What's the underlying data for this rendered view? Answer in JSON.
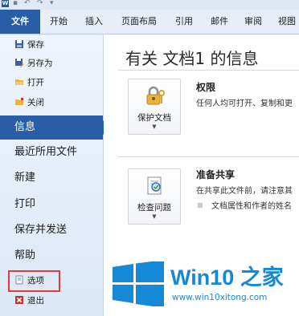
{
  "qat": {
    "app_icon": "W"
  },
  "ribbon": {
    "tabs": [
      {
        "label": "文件"
      },
      {
        "label": "开始"
      },
      {
        "label": "插入"
      },
      {
        "label": "页面布局"
      },
      {
        "label": "引用"
      },
      {
        "label": "邮件"
      },
      {
        "label": "审阅"
      },
      {
        "label": "视图"
      }
    ],
    "active_color": "#2a5da8"
  },
  "backstage": {
    "small_commands": [
      {
        "label": "保存",
        "icon": "save-icon"
      },
      {
        "label": "另存为",
        "icon": "save-as-icon"
      },
      {
        "label": "打开",
        "icon": "open-folder-icon"
      },
      {
        "label": "关闭",
        "icon": "close-folder-icon"
      }
    ],
    "big_commands": [
      {
        "label": "信息",
        "selected": true
      },
      {
        "label": "最近所用文件"
      },
      {
        "label": "新建"
      },
      {
        "label": "打印"
      },
      {
        "label": "保存并发送"
      },
      {
        "label": "帮助"
      }
    ],
    "bottom_commands": [
      {
        "label": "选项",
        "icon": "options-icon"
      },
      {
        "label": "退出",
        "icon": "exit-icon"
      }
    ]
  },
  "info": {
    "title": "有关 文档1 的信息",
    "permissions": {
      "button_label": "保护文档",
      "title": "权限",
      "description": "任何人均可打开、复制和更"
    },
    "prepare": {
      "button_label": "检查问题",
      "title": "准备共享",
      "description": "在共享此文件前，请注意其",
      "bullet": "文档属性和作者的姓名"
    }
  },
  "watermark": {
    "title": "Win10 之家",
    "url": "www.win10xitong.com",
    "logo_color": "#1689d6"
  }
}
